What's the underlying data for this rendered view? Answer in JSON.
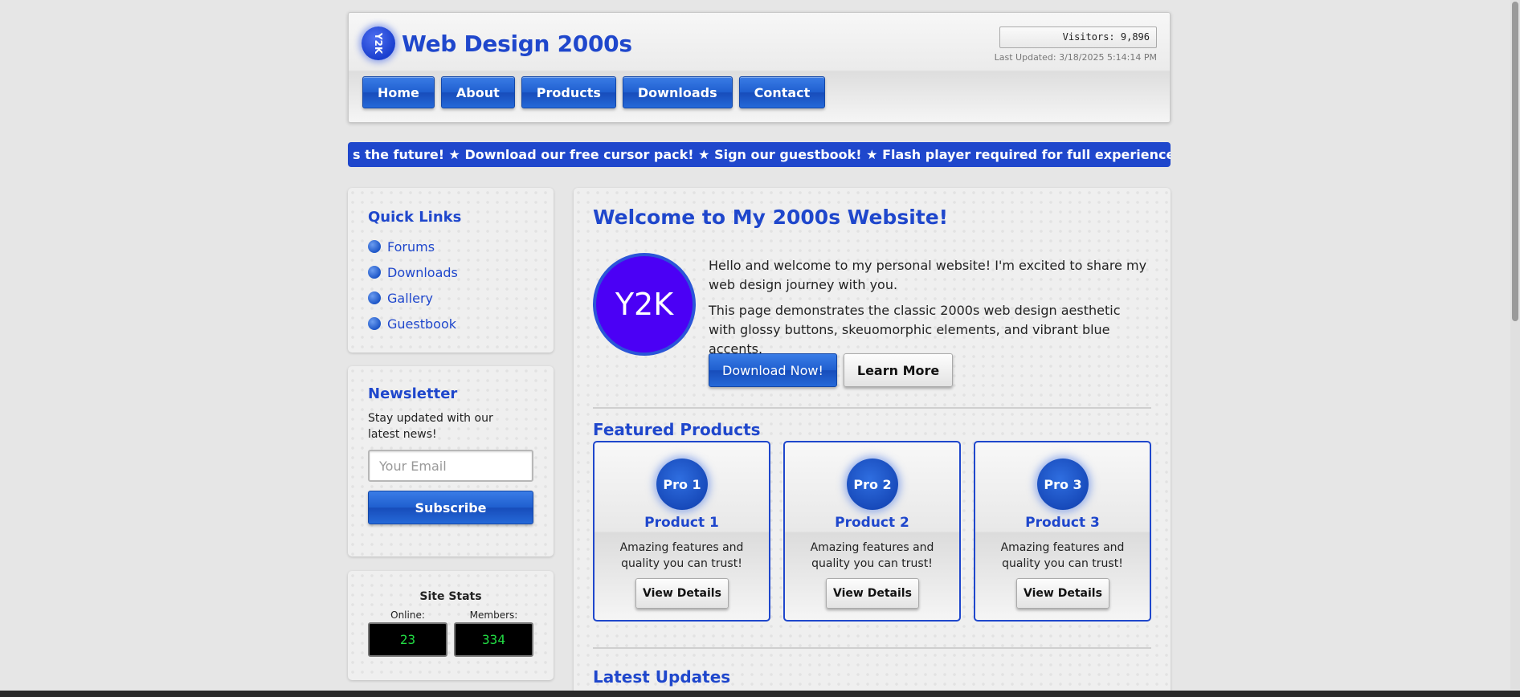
{
  "header": {
    "logo_text": "Y2K",
    "title": "Web Design 2000s",
    "visitors": "Visitors: 9,896",
    "last_updated": "Last Updated: 3/18/2025 5:14:14 PM"
  },
  "nav": {
    "items": [
      {
        "label": "Home"
      },
      {
        "label": "About"
      },
      {
        "label": "Products"
      },
      {
        "label": "Downloads"
      },
      {
        "label": "Contact"
      }
    ]
  },
  "marquee": {
    "text": "s the future! ★ Download our free cursor pack! ★ Sign our guestbook! ★ Flash player required for full experience! ★"
  },
  "quick_links": {
    "title": "Quick Links",
    "items": [
      {
        "label": "Forums"
      },
      {
        "label": "Downloads"
      },
      {
        "label": "Gallery"
      },
      {
        "label": "Guestbook"
      }
    ]
  },
  "newsletter": {
    "title": "Newsletter",
    "text": "Stay updated with our latest news!",
    "email_placeholder": "Your Email",
    "subscribe_label": "Subscribe"
  },
  "site_stats": {
    "title": "Site Stats",
    "online_label": "Online:",
    "online_value": "23",
    "members_label": "Members:",
    "members_value": "334"
  },
  "main": {
    "welcome_title": "Welcome to My 2000s Website!",
    "badge": "Y2K",
    "intro_p1": "Hello and welcome to my personal website! I'm excited to share my web design journey with you.",
    "intro_p2": "This page demonstrates the classic 2000s web design aesthetic with glossy buttons, skeuomorphic elements, and vibrant blue accents.",
    "download_label": "Download Now!",
    "learn_more_label": "Learn More",
    "featured_title": "Featured Products",
    "products": [
      {
        "badge": "Pro 1",
        "name": "Product 1",
        "desc": "Amazing features and quality you can trust!",
        "button": "View Details"
      },
      {
        "badge": "Pro 2",
        "name": "Product 2",
        "desc": "Amazing features and quality you can trust!",
        "button": "View Details"
      },
      {
        "badge": "Pro 3",
        "name": "Product 3",
        "desc": "Amazing features and quality you can trust!",
        "button": "View Details"
      }
    ],
    "updates_title": "Latest Updates"
  },
  "colors": {
    "accent": "#1f47cc",
    "counter_text": "#22dd44",
    "badge_purple": "#4b00f5"
  }
}
